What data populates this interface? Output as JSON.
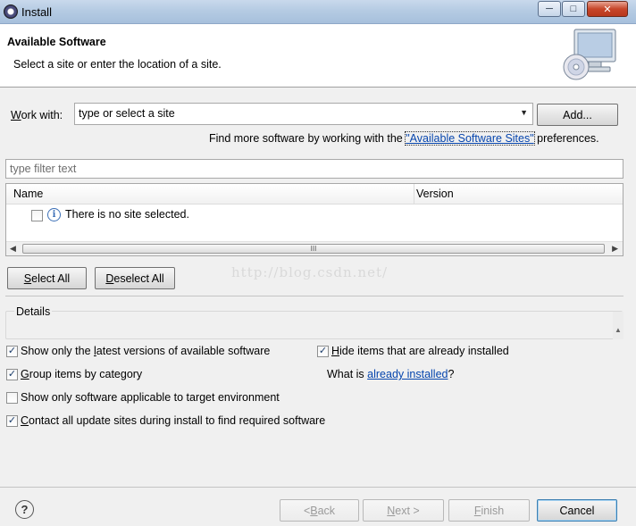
{
  "window": {
    "title": "Install"
  },
  "banner": {
    "heading": "Available Software",
    "subtitle": "Select a site or enter the location of a site."
  },
  "work_with": {
    "label_prefix": "W",
    "label_rest": "ork with:",
    "combo_value": "type or select a site",
    "add_button": "Add..."
  },
  "find_more": {
    "prefix": "Find more software by working with the ",
    "link": "\"Available Software Sites\"",
    "suffix": " preferences."
  },
  "filter": {
    "placeholder": "type filter text"
  },
  "table": {
    "columns": [
      "Name",
      "Version"
    ],
    "rows": [
      {
        "checked": false,
        "icon": "info-icon",
        "text": "There is no site selected."
      }
    ],
    "scroll_thumb": "III"
  },
  "select_all": {
    "prefix": "",
    "accel": "S",
    "rest": "elect All"
  },
  "deselect_all": {
    "prefix": "",
    "accel": "D",
    "rest": "eselect All"
  },
  "watermark": "http://blog.csdn.net/",
  "details": {
    "label": "Details"
  },
  "options": {
    "latest_versions": {
      "checked": true,
      "before": "Show only the ",
      "accel": "l",
      "after": "atest versions of available software"
    },
    "hide_installed": {
      "checked": true,
      "before": "",
      "accel": "H",
      "after": "ide items that are already installed"
    },
    "group_by_category": {
      "checked": true,
      "before": "",
      "accel": "G",
      "after": "roup items by category"
    },
    "what_is_prefix": "What is ",
    "what_is_link": "already installed",
    "what_is_suffix": "?",
    "target_env": {
      "checked": false,
      "before": "Show only software applicable to target ",
      "accel": "",
      "after": "environment"
    },
    "contact_sites": {
      "checked": true,
      "before": "",
      "accel": "C",
      "after": "ontact all update sites during install to find required software"
    }
  },
  "footer": {
    "help": "?",
    "back": {
      "before": "< ",
      "accel": "B",
      "after": "ack"
    },
    "next": {
      "before": "",
      "accel": "N",
      "after": "ext >"
    },
    "finish": {
      "before": "",
      "accel": "F",
      "after": "inish"
    },
    "cancel": "Cancel"
  },
  "colors": {
    "link": "#0645ad",
    "titlebar": "#b5cbe3",
    "close": "#c7462a"
  }
}
